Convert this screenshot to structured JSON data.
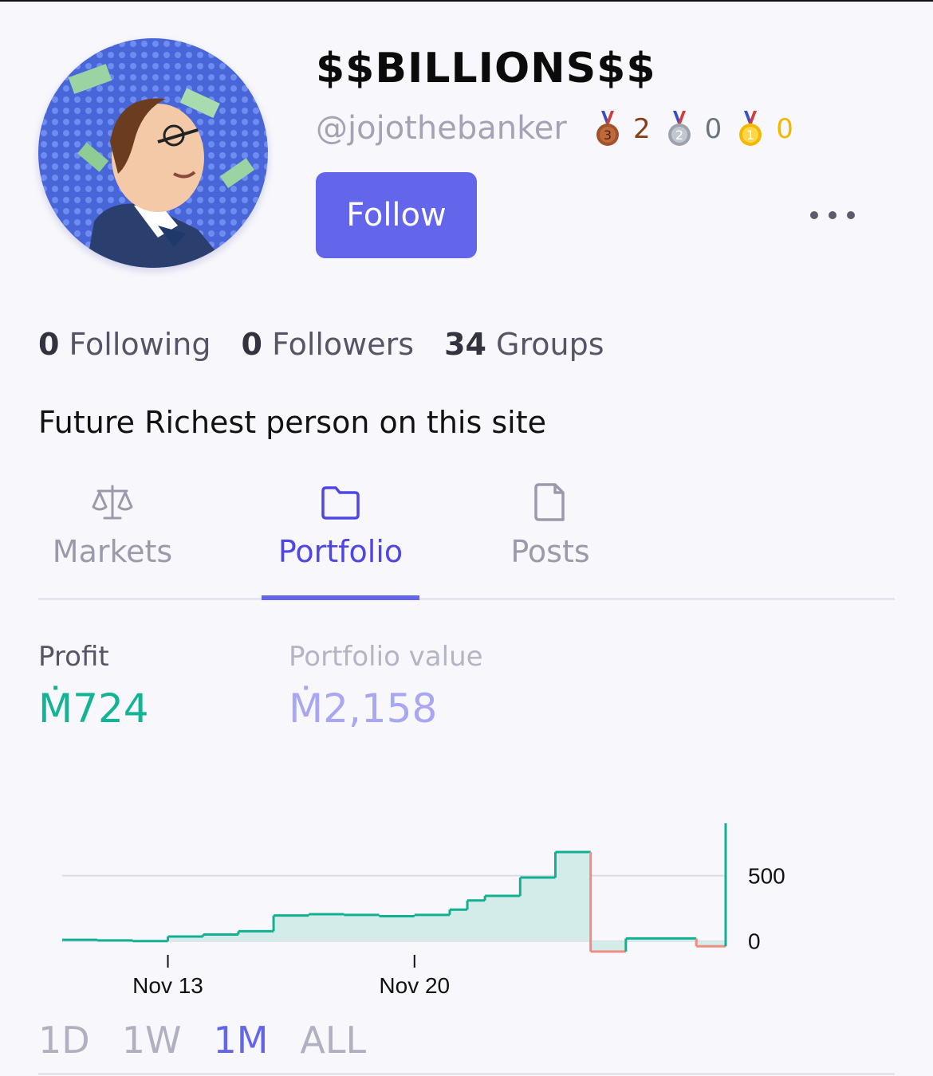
{
  "profile": {
    "display_name": "$$BILLIONS$$",
    "username": "@jojothebanker",
    "follow_label": "Follow",
    "bio": "Future Richest person on this site",
    "medals": [
      {
        "icon": "bronze-medal-icon",
        "rank": "3",
        "count": "2",
        "color": "#a0522d"
      },
      {
        "icon": "silver-medal-icon",
        "rank": "2",
        "count": "0",
        "color": "#9ca3af"
      },
      {
        "icon": "gold-medal-icon",
        "rank": "1",
        "count": "0",
        "color": "#f5b800"
      }
    ]
  },
  "stats": {
    "following_count": "0",
    "following_label": "Following",
    "followers_count": "0",
    "followers_label": "Followers",
    "groups_count": "34",
    "groups_label": "Groups"
  },
  "tabs": [
    {
      "label": "Markets",
      "icon": "scale-icon",
      "active": false
    },
    {
      "label": "Portfolio",
      "icon": "folder-icon",
      "active": true
    },
    {
      "label": "Posts",
      "icon": "document-icon",
      "active": false
    }
  ],
  "metrics": {
    "profit_label": "Profit",
    "profit_value": "Ṁ724",
    "portfolio_label": "Portfolio value",
    "portfolio_value": "Ṁ2,158"
  },
  "chart_data": {
    "type": "line",
    "x_start": "2023-11-10",
    "x": [
      "2023-11-10",
      "2023-11-11",
      "2023-11-12",
      "2023-11-13",
      "2023-11-14",
      "2023-11-15",
      "2023-11-16",
      "2023-11-17",
      "2023-11-18",
      "2023-11-19",
      "2023-11-20",
      "2023-11-21",
      "2023-11-21T12:00",
      "2023-11-22",
      "2023-11-23",
      "2023-11-24",
      "2023-11-25",
      "2023-11-26",
      "2023-11-27",
      "2023-11-28",
      "2023-11-28T20:00"
    ],
    "values": [
      10,
      5,
      0,
      35,
      50,
      75,
      195,
      205,
      200,
      190,
      200,
      240,
      310,
      345,
      485,
      680,
      -80,
      20,
      20,
      -40,
      900
    ],
    "xticks": [
      {
        "x": "2023-11-13",
        "label": "Nov 13"
      },
      {
        "x": "2023-11-20",
        "label": "Nov 20"
      }
    ],
    "yticks": [
      0,
      500
    ],
    "ylim": [
      -300,
      1100
    ],
    "positive_color": "#11b092",
    "negative_color": "#f28b82",
    "fill_color": "#d4ece9"
  },
  "ranges": [
    {
      "label": "1D",
      "active": false
    },
    {
      "label": "1W",
      "active": false
    },
    {
      "label": "1M",
      "active": true
    },
    {
      "label": "ALL",
      "active": false
    }
  ]
}
